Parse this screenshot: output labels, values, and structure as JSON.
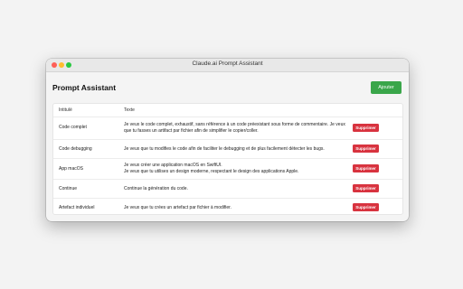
{
  "window": {
    "title": "Claude.ai Prompt Assistant"
  },
  "header": {
    "title": "Prompt Assistant",
    "add_label": "Ajouter"
  },
  "table": {
    "columns": [
      "Intitulé",
      "Texte"
    ],
    "delete_label": "Supprimer",
    "rows": [
      {
        "title": "Code complet",
        "text_lines": [
          "Je veux le code complet, exhaustif, sans référence à un code préexistant sous forme de commentaire. Je veux",
          "que tu fasses un artifact par fichier afin de simplifier le copier/coller."
        ]
      },
      {
        "title": "Code debugging",
        "text_lines": [
          "Je veux que tu modifies le code afin de faciliter le debugging et de plus facilement détecter les bugs."
        ]
      },
      {
        "title": "App macOS",
        "text_lines": [
          "Je veux créer une application macOS en SwiftUI.",
          "Je veux que tu utilises un design moderne, respectant le design des applications Apple."
        ]
      },
      {
        "title": "Continue",
        "text_lines": [
          "Continue la génération du code."
        ]
      },
      {
        "title": "Artefact individuel",
        "text_lines": [
          "Je veux que tu crées un artefact par fichier à modifier."
        ]
      }
    ]
  },
  "colors": {
    "accent_add": "#3aa64a",
    "accent_delete": "#d8333f"
  }
}
